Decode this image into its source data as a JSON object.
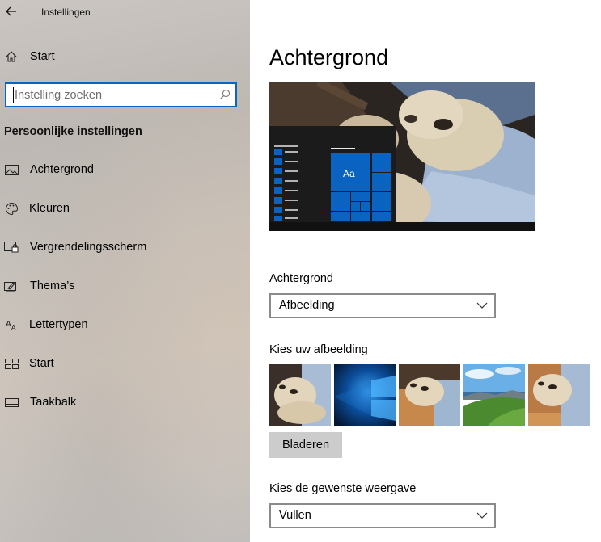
{
  "window": {
    "title": "Instellingen"
  },
  "sidebar": {
    "home_label": "Start",
    "search": {
      "placeholder": "Instelling zoeken",
      "value": ""
    },
    "section_heading": "Persoonlijke instellingen",
    "items": [
      {
        "label": "Achtergrond",
        "icon": "picture-icon"
      },
      {
        "label": "Kleuren",
        "icon": "palette-icon"
      },
      {
        "label": "Vergrendelingsscherm",
        "icon": "lock-screen-icon"
      },
      {
        "label": "Thema’s",
        "icon": "brush-icon"
      },
      {
        "label": "Lettertypen",
        "icon": "font-icon"
      },
      {
        "label": "Start",
        "icon": "start-icon"
      },
      {
        "label": "Taakbalk",
        "icon": "taskbar-icon"
      }
    ]
  },
  "main": {
    "title": "Achtergrond",
    "preview": {
      "tile_text": "Aa",
      "accent_color": "#0a63c1"
    },
    "background": {
      "label": "Achtergrond",
      "selected": "Afbeelding"
    },
    "choose_picture": {
      "label": "Kies uw afbeelding",
      "browse_label": "Bladeren"
    },
    "fit": {
      "label": "Kies de gewenste weergave",
      "selected": "Vullen"
    }
  }
}
